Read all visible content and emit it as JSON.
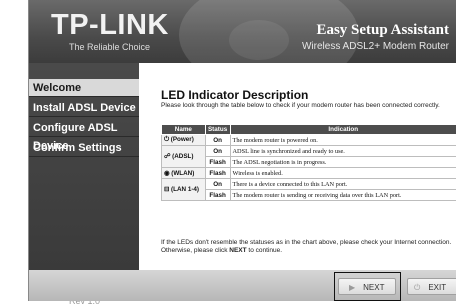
{
  "header": {
    "logo": "TP-LINK",
    "tagline": "The Reliable Choice",
    "title": "Easy Setup Assistant",
    "subtitle": "Wireless ADSL2+ Modem Router"
  },
  "sidebar": {
    "items": [
      {
        "label": "Welcome"
      },
      {
        "label": "Install ADSL Device"
      },
      {
        "label": "Configure ADSL Device"
      },
      {
        "label": "Confirm Settings"
      }
    ],
    "active_index": 0,
    "version": "Rev 1.0"
  },
  "content": {
    "title": "LED Indicator Description",
    "intro": "Please look through the table below to check if your modem router has been connected correctly.",
    "table": {
      "headers": [
        "Name",
        "Status",
        "Indication"
      ],
      "rows": [
        {
          "name": "(Power)",
          "icon": "power-icon",
          "entries": [
            {
              "status": "On",
              "indication": "The modem router is powered on."
            }
          ]
        },
        {
          "name": "(ADSL)",
          "icon": "adsl-icon",
          "entries": [
            {
              "status": "On",
              "indication": "ADSL line is synchronized and ready to use."
            },
            {
              "status": "Flash",
              "indication": "The ADSL negotiation is in progress."
            }
          ]
        },
        {
          "name": "(WLAN)",
          "icon": "wlan-icon",
          "entries": [
            {
              "status": "Flash",
              "indication": "Wireless is enabled."
            }
          ]
        },
        {
          "name": "(LAN 1-4)",
          "icon": "lan-icon",
          "entries": [
            {
              "status": "On",
              "indication": "There is a device connected to this LAN port."
            },
            {
              "status": "Flash",
              "indication": "The modem router is sending or receiving data over this LAN port."
            }
          ]
        }
      ]
    },
    "note_prefix": "If the LEDs don't resemble the statuses as in the chart above, please check your Internet connection. Otherwise, please click ",
    "note_bold": "NEXT",
    "note_suffix": " to continue."
  },
  "footer": {
    "next_label": "NEXT",
    "next_icon": "play-icon",
    "exit_label": "EXIT",
    "exit_icon": "power-off-icon"
  },
  "colors": {
    "header_bg": "#4a4a4a",
    "sidebar_bg": "#3c3c3c",
    "active_item_bg": "#d9d9d9",
    "table_header_bg": "#4d4d4d",
    "footer_bg": "#c8c8c8"
  }
}
